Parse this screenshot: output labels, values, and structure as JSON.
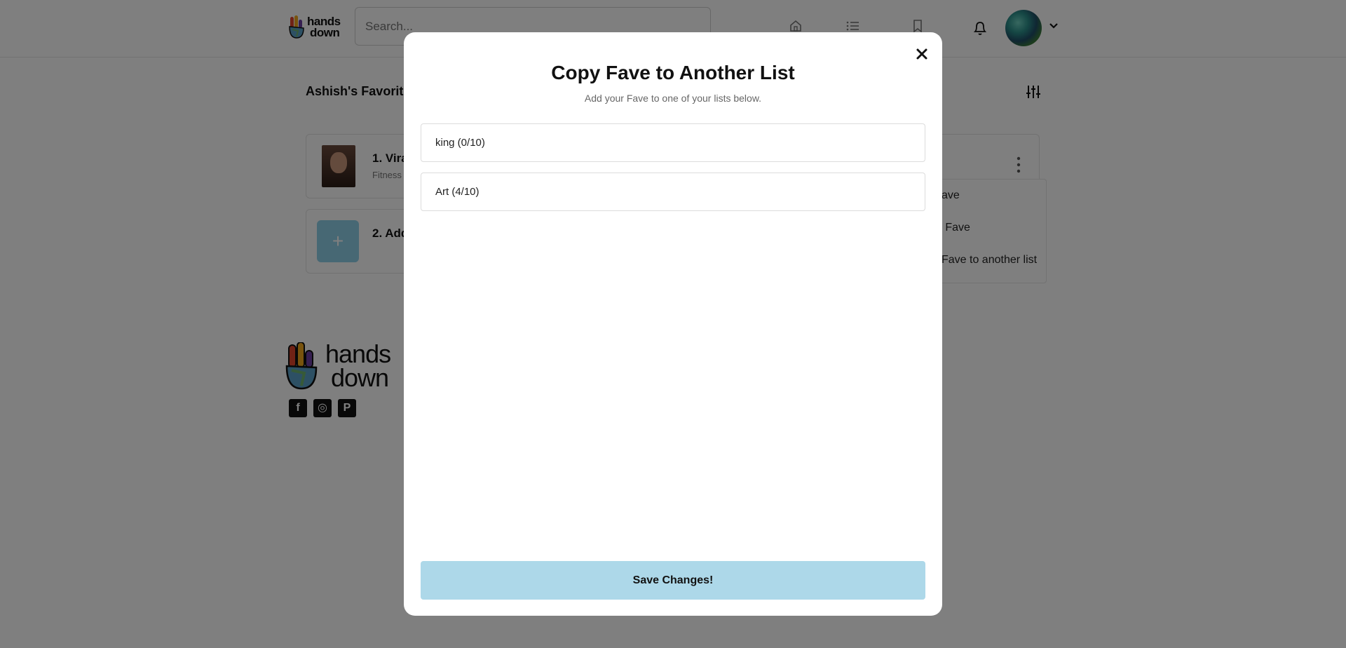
{
  "header": {
    "logo_text_line1": "hands",
    "logo_text_line2": "down",
    "search_placeholder": "Search...",
    "nav_icons": [
      "home-icon",
      "list-icon",
      "bookmark-icon"
    ],
    "notification_icon": "bell-icon"
  },
  "page": {
    "list_title": "Ashish's Favorite T",
    "items": [
      {
        "title": "1. Vira",
        "subtitle": "Fitness"
      },
      {
        "title": "2. Add",
        "plus": "+"
      }
    ],
    "menu": {
      "items": [
        "ave",
        "e Fave",
        "Fave to another list"
      ]
    }
  },
  "footer": {
    "logo_text_line1": "hands",
    "logo_text_line2": "down",
    "social": [
      "f",
      "◎",
      "P"
    ]
  },
  "modal": {
    "title": "Copy Fave to Another List",
    "subtitle": "Add your Fave to one of your lists below.",
    "lists": [
      {
        "label": "king (0/10)"
      },
      {
        "label": "Art (4/10)"
      }
    ],
    "save_label": "Save Changes!"
  },
  "colors": {
    "accent": "#add8e9",
    "overlay": "#7f7f7f"
  }
}
